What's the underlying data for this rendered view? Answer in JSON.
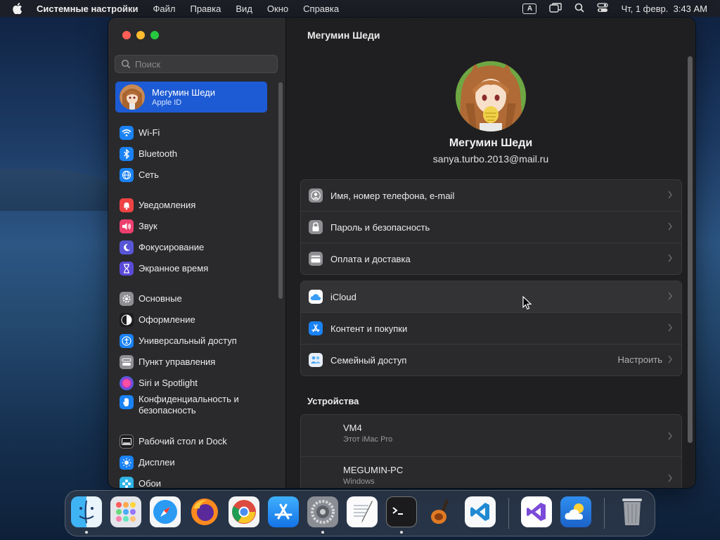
{
  "menubar": {
    "app_name": "Системные настройки",
    "items": [
      "Файл",
      "Правка",
      "Вид",
      "Окно",
      "Справка"
    ],
    "input_indicator": "A",
    "datetime": "Чт, 1 февр.  3:43 AM"
  },
  "sidebar": {
    "search_placeholder": "Поиск",
    "profile": {
      "name": "Мегумин Шеди",
      "subtitle": "Apple ID"
    },
    "items": [
      {
        "label": "Wi-Fi",
        "icon": "wifi-icon",
        "color": "#1a82f4"
      },
      {
        "label": "Bluetooth",
        "icon": "bluetooth-icon",
        "color": "#1a82f4"
      },
      {
        "label": "Сеть",
        "icon": "globe-icon",
        "color": "#1a82f4"
      },
      {
        "label": "Уведомления",
        "icon": "bell-icon",
        "color": "#ee4343"
      },
      {
        "label": "Звук",
        "icon": "speaker-icon",
        "color": "#ec3f6e"
      },
      {
        "label": "Фокусирование",
        "icon": "moon-icon",
        "color": "#5856d6"
      },
      {
        "label": "Экранное время",
        "icon": "hourglass-icon",
        "color": "#5a4ad8"
      },
      {
        "label": "Основные",
        "icon": "gear-icon",
        "color": "#8e8e93"
      },
      {
        "label": "Оформление",
        "icon": "appearance-icon",
        "color": "#1c1c1e"
      },
      {
        "label": "Универсальный доступ",
        "icon": "accessibility-icon",
        "color": "#1a82f4"
      },
      {
        "label": "Пункт управления",
        "icon": "control-center-icon",
        "color": "#8e8e93"
      },
      {
        "label": "Siri и Spotlight",
        "icon": "siri-icon",
        "color": "#7a3cd6"
      },
      {
        "label": "Конфиденциальность и безопасность",
        "icon": "hand-icon",
        "color": "#1a82f4"
      },
      {
        "label": "Рабочий стол и Dock",
        "icon": "desktop-icon",
        "color": "#1c1c1e"
      },
      {
        "label": "Дисплеи",
        "icon": "sun-icon",
        "color": "#1a82f4"
      },
      {
        "label": "Обои",
        "icon": "wallpaper-icon",
        "color": "#2fb3e6"
      }
    ]
  },
  "main": {
    "title": "Мегумин Шеди",
    "user_name": "Мегумин Шеди",
    "email": "sanya.turbo.2013@mail.ru",
    "group1": [
      {
        "label": "Имя, номер телефона, e-mail",
        "icon": "contact-card-icon"
      },
      {
        "label": "Пароль и безопасность",
        "icon": "lock-icon"
      },
      {
        "label": "Оплата и доставка",
        "icon": "credit-card-icon"
      }
    ],
    "group2": [
      {
        "label": "iCloud",
        "icon": "icloud-icon",
        "extra": ""
      },
      {
        "label": "Контент и покупки",
        "icon": "app-store-icon",
        "extra": ""
      },
      {
        "label": "Семейный доступ",
        "icon": "family-icon",
        "extra": "Настроить"
      }
    ],
    "devices_title": "Устройства",
    "devices": [
      {
        "name": "VM4",
        "subtitle": "Этот iMac Pro"
      },
      {
        "name": "MEGUMIN-PC",
        "subtitle": "Windows"
      }
    ]
  },
  "dock": {
    "apps": [
      "finder-icon",
      "launchpad-icon",
      "safari-icon",
      "firefox-icon",
      "chrome-icon",
      "app-store-icon",
      "system-settings-icon",
      "textedit-icon",
      "terminal-icon",
      "garageband-icon",
      "vscode-icon",
      "visual-studio-icon",
      "weather-icon",
      "trash-icon"
    ]
  }
}
